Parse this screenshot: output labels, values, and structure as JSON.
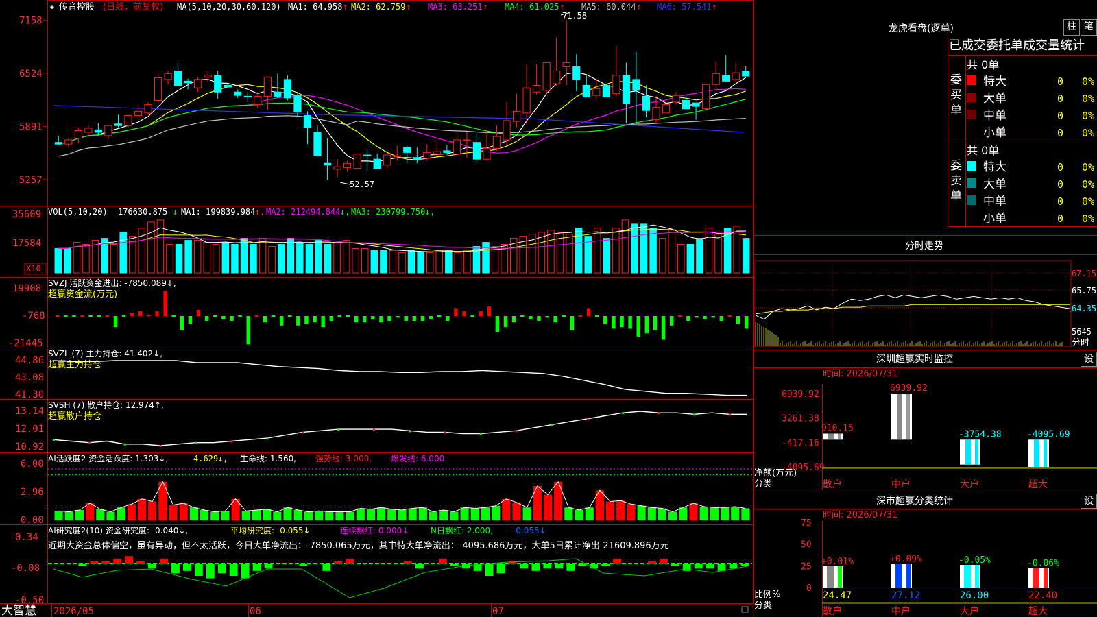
{
  "colors": {
    "up": "#ff2020",
    "down": "#00ffff",
    "frame": "#c00000",
    "axis_label": "#ff3030",
    "ma1": "#ffffff",
    "ma2": "#ffff00",
    "ma3": "#ff00ff",
    "ma4": "#00ff00",
    "ma5": "#c0c0c0",
    "ma6": "#3030ff",
    "green_bar": "#00ff00",
    "red_bar": "#ff0000"
  },
  "header": {
    "star": "★",
    "stock": "传音控股",
    "mode": "(日线，前复权)",
    "ma_params": "MA(5,10,20,30,60,120)",
    "ma_items": [
      {
        "label": "MA1: 64.958",
        "arrow": "↑"
      },
      {
        "label": "MA2: 62.759",
        "arrow": "↑"
      },
      {
        "label": "MA3: 63.251",
        "arrow": "↑"
      },
      {
        "label": "MA4: 61.025",
        "arrow": "↑"
      },
      {
        "label": "MA5: 60.044",
        "arrow": "↑"
      },
      {
        "label": "MA6: 57.541",
        "arrow": "↑"
      }
    ]
  },
  "price_axis": [
    "7158",
    "6524",
    "5891",
    "5257"
  ],
  "price_marks": {
    "high": "71.58",
    "low": "52.57"
  },
  "chart_data": [
    {
      "type": "candlestick",
      "title": "传音控股 日线 前复权",
      "y_range": [
        51.5,
        72.5
      ],
      "x_labels": [
        "2026/05",
        "06",
        "07"
      ],
      "open": [
        57,
        56.8,
        57.5,
        58.2,
        58.5,
        57.8,
        59.2,
        59,
        60.2,
        60.5,
        62,
        64.5,
        65.5,
        64.3,
        63.5,
        64.8,
        65,
        63.8,
        63,
        62.5,
        61.5,
        62.5,
        63,
        64.5,
        62.6,
        60.2,
        58.2,
        54.5,
        53.8,
        54,
        53.9,
        55.5,
        55,
        54.3,
        55.3,
        56.4,
        55.2,
        55.1,
        55.6,
        56,
        55.6,
        57.3,
        57,
        55,
        56.3,
        57.3,
        59.5,
        60.5,
        63,
        63.2,
        64,
        66,
        66,
        63.8,
        62.6,
        63.8,
        62.8,
        65,
        64.5,
        62.5,
        59.7,
        60.5,
        61.8,
        62,
        61.7,
        61,
        63.9,
        65,
        64.5,
        65.5
      ],
      "high": [
        57.8,
        57.5,
        58.8,
        59,
        59.3,
        59,
        60.3,
        60.3,
        61.5,
        61.8,
        65.3,
        65.5,
        66.5,
        64.6,
        64.8,
        65.5,
        65.5,
        64,
        63.3,
        63,
        63,
        63.2,
        65.2,
        65,
        63,
        60.7,
        59,
        57.5,
        55,
        54.8,
        55,
        56.2,
        55.7,
        56,
        56.6,
        56.6,
        56.4,
        56.8,
        57.2,
        56.7,
        58.2,
        58.2,
        58,
        58.5,
        59,
        61.8,
        62.8,
        66.3,
        66.3,
        66,
        69.5,
        71.58,
        67.5,
        65,
        64.7,
        64,
        68.5,
        66.5,
        67.8,
        63.8,
        62.5,
        61.5,
        63,
        62.6,
        61.7,
        63.8,
        66.6,
        67.4,
        66.5,
        66.1
      ],
      "low": [
        56.7,
        56.5,
        56.9,
        57.8,
        57.8,
        57.4,
        58.8,
        58.8,
        60,
        60.3,
        61.8,
        63.9,
        63.8,
        63.3,
        63,
        64.2,
        62.2,
        63.5,
        62.3,
        61.8,
        61.1,
        60.9,
        62.3,
        62,
        60,
        56.8,
        55.5,
        52.57,
        52.8,
        53.5,
        53.8,
        53.6,
        54.5,
        53.9,
        54.8,
        54.5,
        54.5,
        54.8,
        55.3,
        55.5,
        55.4,
        55.2,
        54.5,
        54.8,
        56,
        56.7,
        58.8,
        59.2,
        62.7,
        62.8,
        63.7,
        63.8,
        63.1,
        62.5,
        62,
        62.5,
        62.5,
        59.3,
        59.3,
        60,
        59.3,
        60.5,
        61.5,
        61.7,
        59.7,
        60.8,
        63.4,
        64.3,
        64.2,
        64.9
      ],
      "close": [
        56.8,
        57.3,
        58.4,
        58.7,
        58.2,
        59,
        59,
        60.2,
        60.7,
        61.5,
        64.7,
        65.2,
        63.8,
        64.1,
        64.5,
        65,
        63,
        63.6,
        62.6,
        62.4,
        62.5,
        64.8,
        62.5,
        62.3,
        60.6,
        58.8,
        55.4,
        54.3,
        54.1,
        54.5,
        55.6,
        55.4,
        53.9,
        55.5,
        55.4,
        55.8,
        54.9,
        55.8,
        55.9,
        55.8,
        57.3,
        57.3,
        55,
        56.3,
        57.7,
        59.6,
        60.7,
        63.5,
        63.8,
        66.5,
        65.5,
        66.5,
        64.5,
        62.4,
        63.4,
        62.4,
        65,
        61.6,
        63.2,
        60.8,
        61.2,
        61.5,
        62.6,
        61,
        61.3,
        63.9,
        65.2,
        64.3,
        65.3,
        64.9
      ]
    },
    {
      "type": "bar",
      "title": "VOL(5,10,20)",
      "y_ticks": [
        "35609",
        "17584"
      ],
      "multiplier": "X10",
      "series": [
        {
          "name": "MA1",
          "value": 199839.984
        },
        {
          "name": "MA2",
          "value": 212494.844
        },
        {
          "name": "MA3",
          "value": 230799.75
        }
      ],
      "latest_volume": 176630.875,
      "values": [
        12,
        12,
        15,
        14,
        16,
        17,
        14,
        20,
        18,
        22,
        25,
        26,
        14,
        14,
        16,
        16,
        15,
        14,
        15,
        14,
        17,
        14,
        17,
        13,
        14,
        17,
        15,
        14,
        16,
        14,
        15,
        16,
        12,
        12,
        11,
        11,
        11,
        10,
        11,
        10,
        10,
        11,
        11,
        10,
        11,
        13,
        15,
        13,
        14,
        17,
        18,
        19,
        20,
        21,
        20,
        19,
        22,
        18,
        22,
        17,
        22,
        26,
        24,
        24,
        22,
        17,
        21,
        14,
        14,
        17,
        22,
        19,
        22,
        23,
        17
      ]
    },
    {
      "type": "bar",
      "title": "SVZJ 活跃资金进出",
      "subtitle": "超赢资金流(万元)",
      "latest": -7850.089,
      "y_ticks": [
        "19908",
        "-768",
        "-21445"
      ],
      "values": [
        0,
        0,
        0,
        0,
        0,
        0,
        0,
        -7,
        0,
        2,
        3,
        1,
        3,
        16,
        0,
        -9,
        -5,
        4,
        -3,
        0,
        -2,
        -3,
        0,
        -18,
        0,
        -4,
        0,
        -6,
        0,
        -6,
        -5,
        -4,
        -7,
        -3,
        0,
        0,
        -4,
        -4,
        -2,
        -4,
        -3,
        -1,
        -3,
        -3,
        -3,
        -2,
        0,
        -3,
        5,
        3,
        0,
        3,
        6,
        -10,
        -7,
        -4,
        0,
        -2,
        -3,
        -1,
        -4,
        0,
        -9,
        0,
        5,
        0,
        -5,
        -8,
        -7,
        -8,
        -13,
        -11,
        -9,
        -15,
        -6,
        0,
        -3,
        -1,
        -2,
        -1,
        -3,
        0,
        -5,
        -8
      ]
    },
    {
      "type": "line",
      "title": "SVZL (7) 主力持仓",
      "subtitle": "超赢主力持仓",
      "latest": 41.402,
      "y_ticks": [
        "44.86",
        "43.08",
        "41.30"
      ],
      "values": [
        44.9,
        44.8,
        44.8,
        44.9,
        44.9,
        44.9,
        44.9,
        44.7,
        44.7,
        44.7,
        44.5,
        44.3,
        44.2,
        44.1,
        43.9,
        43.8,
        43.8,
        43.7,
        43.7,
        43.8,
        43.8,
        43.9,
        43.8,
        43.7,
        43.6,
        43.3,
        42.9,
        42.5,
        42.0,
        41.8,
        41.6,
        41.6,
        41.5,
        41.4,
        41.4
      ]
    },
    {
      "type": "line",
      "title": "SVSH (7) 散户持仓",
      "subtitle": "超赢散户持仓",
      "latest": 12.974,
      "y_ticks": [
        "13.14",
        "12.01",
        "10.92"
      ],
      "values": [
        11.3,
        11.2,
        11.1,
        11.2,
        11.0,
        11.0,
        10.9,
        11.0,
        11.1,
        11.1,
        11.2,
        11.3,
        11.4,
        11.6,
        11.8,
        11.9,
        12.0,
        12.0,
        12.0,
        12.0,
        11.9,
        11.8,
        11.8,
        11.7,
        11.7,
        11.8,
        11.9,
        12.1,
        12.3,
        12.5,
        12.7,
        12.9,
        13.1,
        13.2,
        13.1,
        13.1,
        13.0,
        13.1,
        13.0,
        13.0
      ]
    },
    {
      "type": "bar",
      "title": "AI活跃度2 资金活跃度",
      "latest": 1.303,
      "y_ticks": [
        "6.00",
        "2.96",
        "0.00"
      ],
      "labels": [
        {
          "text": "4.629",
          "arrow": "↓"
        },
        {
          "text": "生命线: 1.560"
        },
        {
          "text": "强势线: 3.000"
        },
        {
          "text": "爆发线: 6.000"
        }
      ],
      "values": [
        1.1,
        1.0,
        1.2,
        2.0,
        1.3,
        1.0,
        1.5,
        1.9,
        2.5,
        2.2,
        4.5,
        1.8,
        2.0,
        1.5,
        1.2,
        1.0,
        1.1,
        2.5,
        1.1,
        1.2,
        1.3,
        1.0,
        1.5,
        1.2,
        1.0,
        1.1,
        1.0,
        1.0,
        1.0,
        1.4,
        1.3,
        1.5,
        1.3,
        1.2,
        1.4,
        1.5,
        1.0,
        1.2,
        1.0,
        1.5,
        1.4,
        1.5,
        1.7,
        2.5,
        2.1,
        1.5,
        4.0,
        3.0,
        4.5,
        1.5,
        1.2,
        1.5,
        3.5,
        2.2,
        2.3,
        1.9,
        1.7,
        1.5,
        1.4,
        1.0,
        1.5,
        2.0,
        1.6,
        1.5,
        1.5,
        1.6,
        1.4
      ]
    },
    {
      "type": "bar",
      "title": "AI研究度2(10) 资金研究度",
      "latest": -0.04,
      "y_ticks": [
        "0.34",
        "-0.08",
        "-0.50"
      ],
      "labels": [
        {
          "text": "平均研究度: -0.055",
          "arrow": "↓"
        },
        {
          "text": "连续飘红: 0.000",
          "arrow": "↓"
        },
        {
          "text": "N日飘红: 2.000,"
        },
        {
          "text": "-0.055",
          "arrow": "↓"
        }
      ],
      "comment": "近期大资金总体偏空，虽有异动，但不太活跃，今日大单净流出：-7850.065万元，其中特大单净流出：-4095.686万元，大单5日累计净出-21609.896万元",
      "values": [
        0,
        0,
        -1,
        1,
        1,
        2,
        3,
        1,
        -2,
        2,
        -4,
        -3,
        -5,
        -6,
        -4,
        -5,
        -6,
        -3,
        -2,
        0,
        0,
        -1,
        0,
        -3,
        1,
        2,
        0,
        0,
        0,
        0,
        1,
        -2,
        0,
        2,
        -1,
        -2,
        -3,
        -5,
        -4,
        1,
        -2,
        -3,
        -2,
        -2,
        -3,
        -1,
        -2,
        -1,
        2,
        0,
        0,
        1,
        2,
        -1,
        -3,
        -2,
        -2,
        -3,
        -2,
        -1
      ]
    }
  ],
  "right": {
    "lhb": {
      "title": "龙虎看盘(逐单)",
      "btn1": "柱",
      "btn2": "笔",
      "subtitle": "已成交委托单成交量统计",
      "buy": {
        "label": [
          "委",
          "买",
          "单"
        ],
        "total": "共 0单",
        "rows": [
          {
            "name": "特大",
            "val": "0",
            "pct": "0%"
          },
          {
            "name": "大单",
            "val": "0",
            "pct": "0%"
          },
          {
            "name": "中单",
            "val": "0",
            "pct": "0%"
          },
          {
            "name": "小单",
            "val": "0",
            "pct": "0%"
          }
        ]
      },
      "sell": {
        "label": [
          "委",
          "卖",
          "单"
        ],
        "total": "共 0单",
        "rows": [
          {
            "name": "特大",
            "val": "0",
            "pct": "0%"
          },
          {
            "name": "大单",
            "val": "0",
            "pct": "0%"
          },
          {
            "name": "中单",
            "val": "0",
            "pct": "0%"
          },
          {
            "name": "小单",
            "val": "0",
            "pct": "0%"
          }
        ]
      }
    },
    "fenshi": {
      "title": "分时走势",
      "ticks": [
        "67.15",
        "65.75",
        "64.35",
        "5645"
      ],
      "vol_label": "分时",
      "chart_data": {
        "type": "line",
        "price": [
          64.1,
          63.8,
          64.4,
          64.6,
          64.5,
          64.6,
          64.8,
          64.5,
          64.7,
          64.6,
          65.0,
          65.3,
          65.2,
          65.3,
          65.5,
          65.6,
          65.4,
          65.6,
          65.5,
          65.4,
          65.5,
          65.6,
          65.5,
          65.3,
          65.4,
          65.5,
          65.4,
          65.3,
          65.4,
          65.3,
          65.4,
          65.2,
          65.1,
          64.9,
          64.8,
          64.7,
          64.6
        ],
        "avg": [
          64.2,
          64.3,
          64.4,
          64.4,
          64.5,
          64.5,
          64.5,
          64.6,
          64.6,
          64.6,
          64.7,
          64.7,
          64.7,
          64.8,
          64.8,
          64.8,
          64.8,
          64.8,
          64.9,
          64.9,
          64.9,
          64.9,
          64.9,
          64.9,
          64.9,
          64.9,
          64.9,
          64.9,
          64.9,
          64.9,
          64.9,
          64.9,
          64.9,
          64.9,
          64.9,
          64.9,
          64.9
        ]
      }
    },
    "sz_monitor": {
      "title": "深圳超赢实时监控",
      "btn": "设",
      "time": "时间: 2026/07/31",
      "ticks": [
        "6939.92",
        "3261.38",
        "-417.16",
        "-4095.69"
      ],
      "ylabel": "净额(万元)",
      "xlabel": "分类",
      "chart_data": {
        "type": "bar",
        "categories": [
          "散户",
          "中户",
          "大户",
          "超大"
        ],
        "values": [
          910.15,
          6939.92,
          -3754.38,
          -4095.69
        ],
        "ylim": [
          -4095.69,
          6939.92
        ]
      }
    },
    "sz_class": {
      "title": "深市超赢分类统计",
      "btn": "设",
      "time": "时间: 2026/07/31",
      "ticks": [
        "75",
        "50",
        "25",
        "0"
      ],
      "ylabel": "比例%",
      "xlabel": "分类",
      "chart_data": {
        "type": "bar",
        "categories": [
          "散户",
          "中户",
          "大户",
          "超大"
        ],
        "values": [
          24.47,
          27.12,
          26.0,
          22.4
        ],
        "changes": [
          "+0.01%",
          "+0.09%",
          "-0.05%",
          "-0.06%"
        ],
        "ylim": [
          0,
          75
        ]
      }
    }
  },
  "footer": {
    "logo": "大智慧",
    "dates": [
      "2026/05",
      "06",
      "07"
    ]
  }
}
